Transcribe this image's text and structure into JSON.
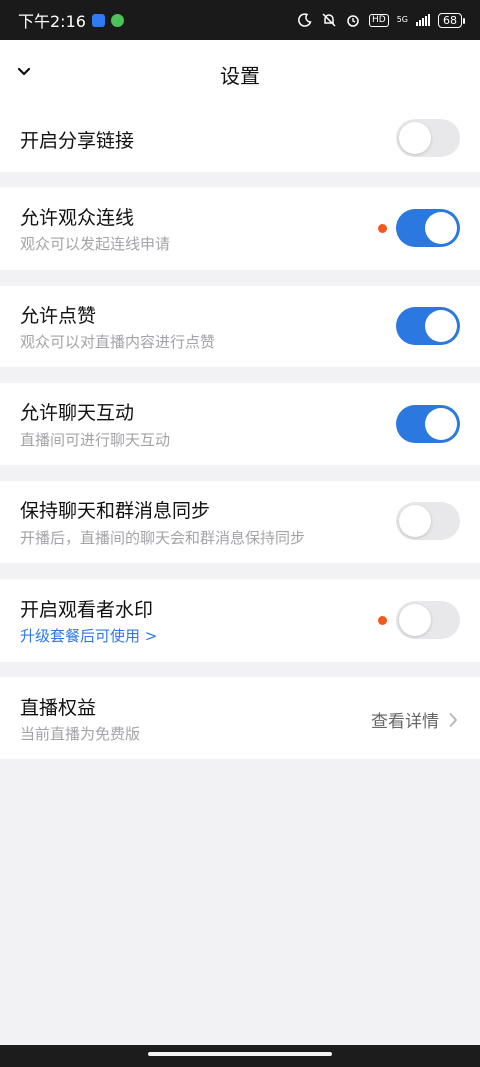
{
  "status_bar": {
    "time": "下午2:16",
    "network": "5G",
    "battery": "68",
    "hd_label": "HD",
    "icons": [
      "app-notification-icon",
      "wechat-icon",
      "moon-icon",
      "mute-icon",
      "alarm-icon",
      "hd-icon",
      "signal-icon",
      "battery-icon"
    ]
  },
  "header": {
    "title": "设置",
    "back_icon": "chevron-down-icon"
  },
  "settings": [
    {
      "title": "开启分享链接",
      "subtitle": "",
      "enabled": false,
      "badge": false
    },
    {
      "title": "允许观众连线",
      "subtitle": "观众可以发起连线申请",
      "enabled": true,
      "badge": true
    },
    {
      "title": "允许点赞",
      "subtitle": "观众可以对直播内容进行点赞",
      "enabled": true,
      "badge": false
    },
    {
      "title": "允许聊天互动",
      "subtitle": "直播间可进行聊天互动",
      "enabled": true,
      "badge": false
    },
    {
      "title": "保持聊天和群消息同步",
      "subtitle": "开播后，直播间的聊天会和群消息保持同步",
      "enabled": false,
      "badge": false
    },
    {
      "title": "开启观看者水印",
      "subtitle": "升级套餐后可使用 >",
      "enabled": false,
      "badge": true
    }
  ],
  "benefits": {
    "title": "直播权益",
    "subtitle": "当前直播为免费版",
    "action": "查看详情"
  },
  "colors": {
    "accent": "#2a78e0",
    "toggle_off": "#e8e8ea",
    "badge": "#f25a1d",
    "link": "#2f77e8",
    "background": "#f2f2f5"
  }
}
